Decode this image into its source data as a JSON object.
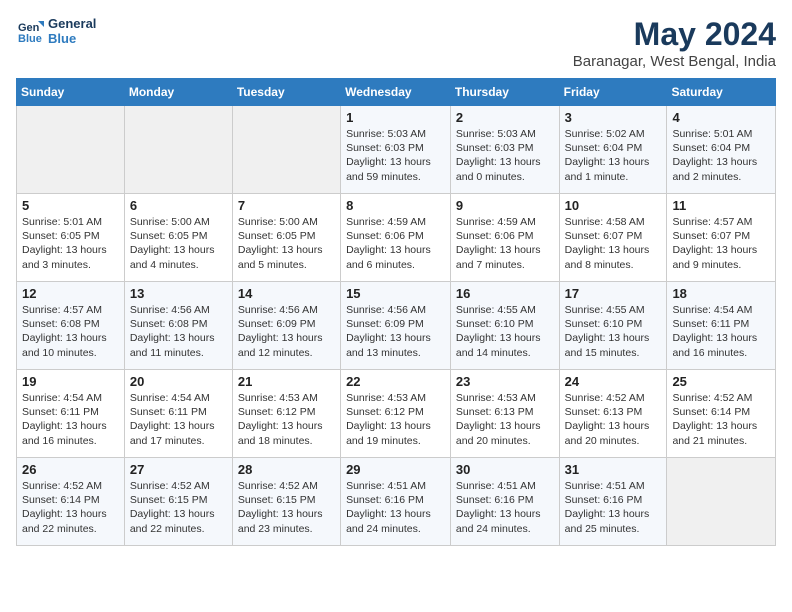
{
  "logo": {
    "line1": "General",
    "line2": "Blue"
  },
  "title": "May 2024",
  "subtitle": "Baranagar, West Bengal, India",
  "weekdays": [
    "Sunday",
    "Monday",
    "Tuesday",
    "Wednesday",
    "Thursday",
    "Friday",
    "Saturday"
  ],
  "weeks": [
    [
      {
        "day": "",
        "info": ""
      },
      {
        "day": "",
        "info": ""
      },
      {
        "day": "",
        "info": ""
      },
      {
        "day": "1",
        "info": "Sunrise: 5:03 AM\nSunset: 6:03 PM\nDaylight: 13 hours\nand 59 minutes."
      },
      {
        "day": "2",
        "info": "Sunrise: 5:03 AM\nSunset: 6:03 PM\nDaylight: 13 hours\nand 0 minutes."
      },
      {
        "day": "3",
        "info": "Sunrise: 5:02 AM\nSunset: 6:04 PM\nDaylight: 13 hours\nand 1 minute."
      },
      {
        "day": "4",
        "info": "Sunrise: 5:01 AM\nSunset: 6:04 PM\nDaylight: 13 hours\nand 2 minutes."
      }
    ],
    [
      {
        "day": "5",
        "info": "Sunrise: 5:01 AM\nSunset: 6:05 PM\nDaylight: 13 hours\nand 3 minutes."
      },
      {
        "day": "6",
        "info": "Sunrise: 5:00 AM\nSunset: 6:05 PM\nDaylight: 13 hours\nand 4 minutes."
      },
      {
        "day": "7",
        "info": "Sunrise: 5:00 AM\nSunset: 6:05 PM\nDaylight: 13 hours\nand 5 minutes."
      },
      {
        "day": "8",
        "info": "Sunrise: 4:59 AM\nSunset: 6:06 PM\nDaylight: 13 hours\nand 6 minutes."
      },
      {
        "day": "9",
        "info": "Sunrise: 4:59 AM\nSunset: 6:06 PM\nDaylight: 13 hours\nand 7 minutes."
      },
      {
        "day": "10",
        "info": "Sunrise: 4:58 AM\nSunset: 6:07 PM\nDaylight: 13 hours\nand 8 minutes."
      },
      {
        "day": "11",
        "info": "Sunrise: 4:57 AM\nSunset: 6:07 PM\nDaylight: 13 hours\nand 9 minutes."
      }
    ],
    [
      {
        "day": "12",
        "info": "Sunrise: 4:57 AM\nSunset: 6:08 PM\nDaylight: 13 hours\nand 10 minutes."
      },
      {
        "day": "13",
        "info": "Sunrise: 4:56 AM\nSunset: 6:08 PM\nDaylight: 13 hours\nand 11 minutes."
      },
      {
        "day": "14",
        "info": "Sunrise: 4:56 AM\nSunset: 6:09 PM\nDaylight: 13 hours\nand 12 minutes."
      },
      {
        "day": "15",
        "info": "Sunrise: 4:56 AM\nSunset: 6:09 PM\nDaylight: 13 hours\nand 13 minutes."
      },
      {
        "day": "16",
        "info": "Sunrise: 4:55 AM\nSunset: 6:10 PM\nDaylight: 13 hours\nand 14 minutes."
      },
      {
        "day": "17",
        "info": "Sunrise: 4:55 AM\nSunset: 6:10 PM\nDaylight: 13 hours\nand 15 minutes."
      },
      {
        "day": "18",
        "info": "Sunrise: 4:54 AM\nSunset: 6:11 PM\nDaylight: 13 hours\nand 16 minutes."
      }
    ],
    [
      {
        "day": "19",
        "info": "Sunrise: 4:54 AM\nSunset: 6:11 PM\nDaylight: 13 hours\nand 16 minutes."
      },
      {
        "day": "20",
        "info": "Sunrise: 4:54 AM\nSunset: 6:11 PM\nDaylight: 13 hours\nand 17 minutes."
      },
      {
        "day": "21",
        "info": "Sunrise: 4:53 AM\nSunset: 6:12 PM\nDaylight: 13 hours\nand 18 minutes."
      },
      {
        "day": "22",
        "info": "Sunrise: 4:53 AM\nSunset: 6:12 PM\nDaylight: 13 hours\nand 19 minutes."
      },
      {
        "day": "23",
        "info": "Sunrise: 4:53 AM\nSunset: 6:13 PM\nDaylight: 13 hours\nand 20 minutes."
      },
      {
        "day": "24",
        "info": "Sunrise: 4:52 AM\nSunset: 6:13 PM\nDaylight: 13 hours\nand 20 minutes."
      },
      {
        "day": "25",
        "info": "Sunrise: 4:52 AM\nSunset: 6:14 PM\nDaylight: 13 hours\nand 21 minutes."
      }
    ],
    [
      {
        "day": "26",
        "info": "Sunrise: 4:52 AM\nSunset: 6:14 PM\nDaylight: 13 hours\nand 22 minutes."
      },
      {
        "day": "27",
        "info": "Sunrise: 4:52 AM\nSunset: 6:15 PM\nDaylight: 13 hours\nand 22 minutes."
      },
      {
        "day": "28",
        "info": "Sunrise: 4:52 AM\nSunset: 6:15 PM\nDaylight: 13 hours\nand 23 minutes."
      },
      {
        "day": "29",
        "info": "Sunrise: 4:51 AM\nSunset: 6:16 PM\nDaylight: 13 hours\nand 24 minutes."
      },
      {
        "day": "30",
        "info": "Sunrise: 4:51 AM\nSunset: 6:16 PM\nDaylight: 13 hours\nand 24 minutes."
      },
      {
        "day": "31",
        "info": "Sunrise: 4:51 AM\nSunset: 6:16 PM\nDaylight: 13 hours\nand 25 minutes."
      },
      {
        "day": "",
        "info": ""
      }
    ]
  ]
}
